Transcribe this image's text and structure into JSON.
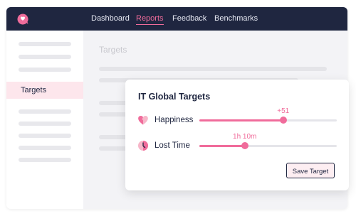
{
  "nav": {
    "items": [
      {
        "label": "Dashboard",
        "active": false
      },
      {
        "label": "Reports",
        "active": true
      },
      {
        "label": "Feedback",
        "active": false
      },
      {
        "label": "Benchmarks",
        "active": false
      }
    ]
  },
  "sidebar": {
    "active_label": "Targets"
  },
  "main": {
    "title": "Targets"
  },
  "card": {
    "title": "IT Global Targets",
    "rows": [
      {
        "label": "Happiness",
        "icon": "heart-icon",
        "value_label": "+51",
        "level": 0.61
      },
      {
        "label": "Lost Time",
        "icon": "clock-icon",
        "value_label": "1h 10m",
        "level": 0.33
      }
    ],
    "save_label": "Save Target"
  },
  "colors": {
    "accent": "#f06c9b",
    "topbar": "#1f2640",
    "highlight": "#fde6ec"
  }
}
